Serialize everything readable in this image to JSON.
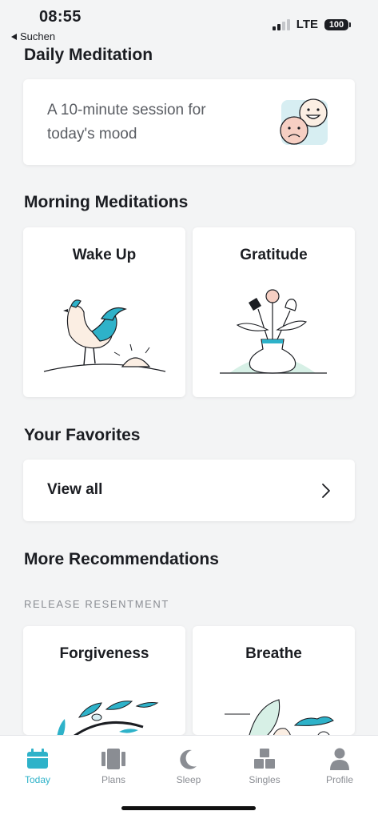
{
  "status": {
    "time": "08:55",
    "back_label": "Suchen",
    "network": "LTE",
    "battery": "100"
  },
  "daily": {
    "title": "Daily Meditation",
    "subtitle": "A 10-minute session for today's mood"
  },
  "morning": {
    "title": "Morning Meditations",
    "tiles": [
      {
        "label": "Wake Up"
      },
      {
        "label": "Gratitude"
      }
    ]
  },
  "favorites": {
    "title": "Your Favorites",
    "view_all": "View all"
  },
  "recommendations": {
    "title": "More Recommendations",
    "eyebrow": "RELEASE RESENTMENT",
    "tiles": [
      {
        "label": "Forgiveness"
      },
      {
        "label": "Breathe"
      }
    ]
  },
  "tabs": [
    {
      "label": "Today",
      "icon": "calendar-icon",
      "active": true
    },
    {
      "label": "Plans",
      "icon": "plans-icon",
      "active": false
    },
    {
      "label": "Sleep",
      "icon": "moon-icon",
      "active": false
    },
    {
      "label": "Singles",
      "icon": "blocks-icon",
      "active": false
    },
    {
      "label": "Profile",
      "icon": "person-icon",
      "active": false
    }
  ],
  "colors": {
    "accent": "#2eb2c9",
    "background": "#f3f4f5",
    "inactive": "#8a8d93"
  }
}
